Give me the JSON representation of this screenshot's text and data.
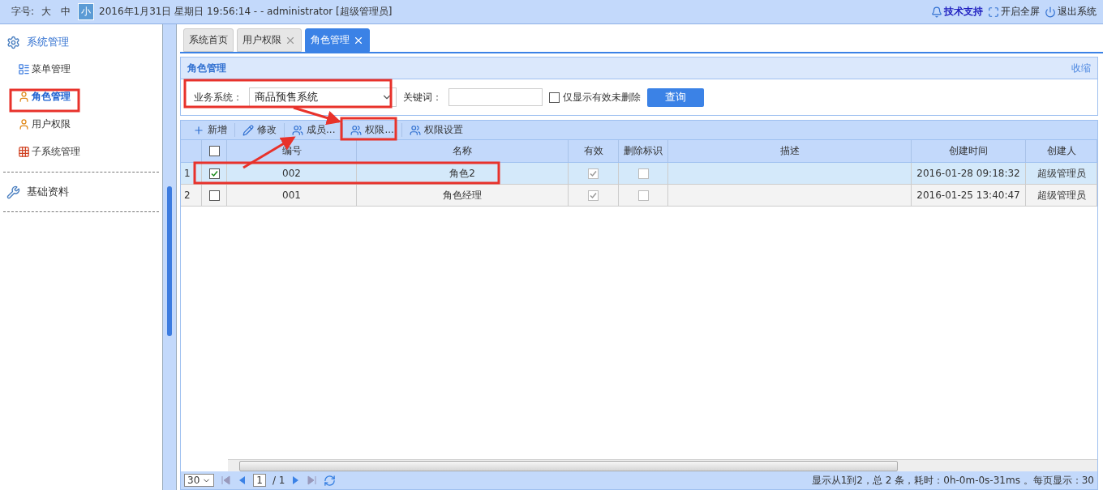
{
  "top_bar": {
    "font_size_label": "字号:",
    "font_sizes": [
      {
        "label": "大",
        "selected": false
      },
      {
        "label": "中",
        "selected": false
      },
      {
        "label": "小",
        "selected": true
      }
    ],
    "session": "2016年1月31日 星期日 19:56:14 - - administrator [超级管理员]",
    "links": [
      {
        "label": "技术支持",
        "kind": "support"
      },
      {
        "label": "开启全屏",
        "kind": "fullscreen"
      },
      {
        "label": "退出系统",
        "kind": "logout"
      }
    ]
  },
  "sidebar": {
    "groups": [
      {
        "title": "系统管理",
        "kind": "gears",
        "expanded": true,
        "items": [
          {
            "label": "菜单管理",
            "kind": "menu",
            "selected": false
          },
          {
            "label": "角色管理",
            "kind": "user",
            "selected": true
          },
          {
            "label": "用户权限",
            "kind": "user",
            "selected": false
          },
          {
            "label": "子系统管理",
            "kind": "grid",
            "selected": false
          }
        ]
      },
      {
        "title": "基础资料",
        "kind": "tools",
        "expanded": false
      }
    ]
  },
  "tabs": [
    {
      "label": "系统首页",
      "closable": false,
      "selected": false
    },
    {
      "label": "用户权限",
      "closable": true,
      "selected": false
    },
    {
      "label": "角色管理",
      "closable": true,
      "selected": true
    }
  ],
  "panel": {
    "title": "角色管理",
    "collapse": "收缩",
    "system_label": "业务系统：",
    "system_value": "商品预售系统",
    "keyword_label": "关键词：",
    "only_valid": {
      "label": "仅显示有效未删除",
      "checked": false
    },
    "query": "查询"
  },
  "toolbar": [
    {
      "label": "新增",
      "kind": "add"
    },
    {
      "label": "修改",
      "kind": "edit"
    },
    {
      "label": "成员...",
      "kind": "users"
    },
    {
      "label": "权限...",
      "kind": "users"
    },
    {
      "label": "权限设置",
      "kind": "users"
    }
  ],
  "table": {
    "all_checked": false,
    "columns": [
      "编号",
      "名称",
      "有效",
      "删除标识",
      "描述",
      "创建时间",
      "创建人"
    ],
    "rows": [
      {
        "index": "1",
        "checked": true,
        "selected": true,
        "code": "002",
        "name": "角色2",
        "valid": true,
        "deleted": false,
        "created": "2016-01-28 09:18:32",
        "creator": "超级管理员"
      },
      {
        "index": "2",
        "checked": false,
        "selected": false,
        "code": "001",
        "name": "角色经理",
        "valid": true,
        "deleted": false,
        "created": "2016-01-25 13:40:47",
        "creator": "超级管理员"
      }
    ]
  },
  "pager": {
    "page_size": "30",
    "page": "1",
    "total_pages": "/ 1",
    "status": "显示从1到2，总 2 条，耗时：0h-0m-0s-31ms 。每页显示：30"
  }
}
